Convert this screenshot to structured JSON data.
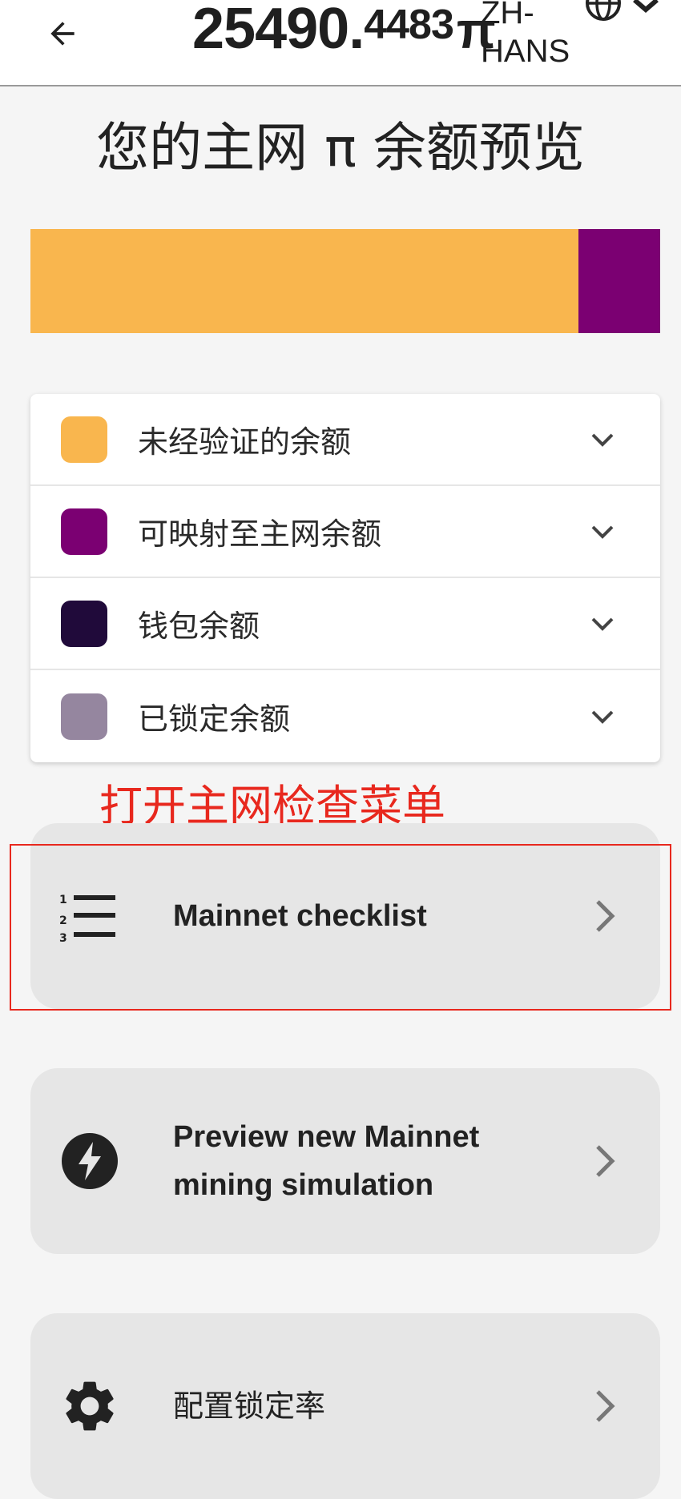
{
  "header": {
    "balance_int": "25490.",
    "balance_dec": "4483",
    "currency_symbol": "π",
    "language": "ZH-HANS",
    "back_icon": "arrow-left-icon",
    "language_icon": "globe-icon"
  },
  "title": "您的主网 π 余额预览",
  "balance_bar": {
    "segments": [
      {
        "name": "未经验证的余额",
        "fraction": 0.87,
        "color": "#F9B64E"
      },
      {
        "name": "可映射至主网余额",
        "fraction": 0.13,
        "color": "#7B0072"
      }
    ]
  },
  "legend": [
    {
      "label": "未经验证的余额",
      "color": "#F9B64E"
    },
    {
      "label": "可映射至主网余额",
      "color": "#7B0072"
    },
    {
      "label": "钱包余额",
      "color": "#200A3A"
    },
    {
      "label": "已锁定余额",
      "color": "#95869F"
    }
  ],
  "annotation": {
    "text": "打开主网检查菜单",
    "color": "#E8281E"
  },
  "actions": [
    {
      "label": "Mainnet checklist",
      "icon": "numbered-list-icon"
    },
    {
      "label": "Preview new Mainnet mining simulation",
      "icon": "lightning-icon"
    },
    {
      "label": "配置锁定率",
      "icon": "gear-icon"
    }
  ]
}
